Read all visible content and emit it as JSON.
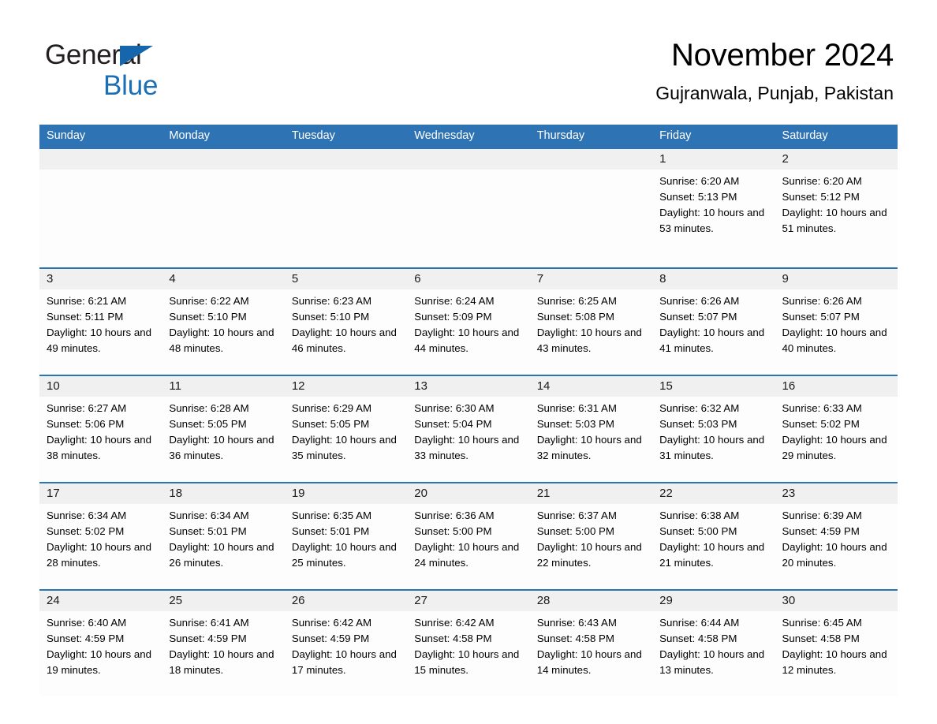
{
  "brand": {
    "name_part1": "General",
    "name_part2": "Blue",
    "triangle_color": "#1566ad",
    "blue_color": "#1b6fb5"
  },
  "header": {
    "title": "November 2024",
    "subtitle": "Gujranwala, Punjab, Pakistan"
  },
  "theme": {
    "header_blue": "#2e74b5",
    "date_strip_gray": "#f0f0f0",
    "cell_background": "#fdfdfd",
    "text_color": "#000000"
  },
  "weekdays": [
    "Sunday",
    "Monday",
    "Tuesday",
    "Wednesday",
    "Thursday",
    "Friday",
    "Saturday"
  ],
  "labels": {
    "sunrise_prefix": "Sunrise:",
    "sunset_prefix": "Sunset:",
    "daylight_prefix": "Daylight:"
  },
  "weeks": [
    {
      "days": [
        {
          "date": "",
          "empty": true
        },
        {
          "date": "",
          "empty": true
        },
        {
          "date": "",
          "empty": true
        },
        {
          "date": "",
          "empty": true
        },
        {
          "date": "",
          "empty": true
        },
        {
          "date": "1",
          "empty": false,
          "sunrise": "Sunrise: 6:20 AM",
          "sunset": "Sunset: 5:13 PM",
          "daylight": "Daylight: 10 hours and 53 minutes."
        },
        {
          "date": "2",
          "empty": false,
          "sunrise": "Sunrise: 6:20 AM",
          "sunset": "Sunset: 5:12 PM",
          "daylight": "Daylight: 10 hours and 51 minutes."
        }
      ]
    },
    {
      "days": [
        {
          "date": "3",
          "empty": false,
          "sunrise": "Sunrise: 6:21 AM",
          "sunset": "Sunset: 5:11 PM",
          "daylight": "Daylight: 10 hours and 49 minutes."
        },
        {
          "date": "4",
          "empty": false,
          "sunrise": "Sunrise: 6:22 AM",
          "sunset": "Sunset: 5:10 PM",
          "daylight": "Daylight: 10 hours and 48 minutes."
        },
        {
          "date": "5",
          "empty": false,
          "sunrise": "Sunrise: 6:23 AM",
          "sunset": "Sunset: 5:10 PM",
          "daylight": "Daylight: 10 hours and 46 minutes."
        },
        {
          "date": "6",
          "empty": false,
          "sunrise": "Sunrise: 6:24 AM",
          "sunset": "Sunset: 5:09 PM",
          "daylight": "Daylight: 10 hours and 44 minutes."
        },
        {
          "date": "7",
          "empty": false,
          "sunrise": "Sunrise: 6:25 AM",
          "sunset": "Sunset: 5:08 PM",
          "daylight": "Daylight: 10 hours and 43 minutes."
        },
        {
          "date": "8",
          "empty": false,
          "sunrise": "Sunrise: 6:26 AM",
          "sunset": "Sunset: 5:07 PM",
          "daylight": "Daylight: 10 hours and 41 minutes."
        },
        {
          "date": "9",
          "empty": false,
          "sunrise": "Sunrise: 6:26 AM",
          "sunset": "Sunset: 5:07 PM",
          "daylight": "Daylight: 10 hours and 40 minutes."
        }
      ]
    },
    {
      "days": [
        {
          "date": "10",
          "empty": false,
          "sunrise": "Sunrise: 6:27 AM",
          "sunset": "Sunset: 5:06 PM",
          "daylight": "Daylight: 10 hours and 38 minutes."
        },
        {
          "date": "11",
          "empty": false,
          "sunrise": "Sunrise: 6:28 AM",
          "sunset": "Sunset: 5:05 PM",
          "daylight": "Daylight: 10 hours and 36 minutes."
        },
        {
          "date": "12",
          "empty": false,
          "sunrise": "Sunrise: 6:29 AM",
          "sunset": "Sunset: 5:05 PM",
          "daylight": "Daylight: 10 hours and 35 minutes."
        },
        {
          "date": "13",
          "empty": false,
          "sunrise": "Sunrise: 6:30 AM",
          "sunset": "Sunset: 5:04 PM",
          "daylight": "Daylight: 10 hours and 33 minutes."
        },
        {
          "date": "14",
          "empty": false,
          "sunrise": "Sunrise: 6:31 AM",
          "sunset": "Sunset: 5:03 PM",
          "daylight": "Daylight: 10 hours and 32 minutes."
        },
        {
          "date": "15",
          "empty": false,
          "sunrise": "Sunrise: 6:32 AM",
          "sunset": "Sunset: 5:03 PM",
          "daylight": "Daylight: 10 hours and 31 minutes."
        },
        {
          "date": "16",
          "empty": false,
          "sunrise": "Sunrise: 6:33 AM",
          "sunset": "Sunset: 5:02 PM",
          "daylight": "Daylight: 10 hours and 29 minutes."
        }
      ]
    },
    {
      "days": [
        {
          "date": "17",
          "empty": false,
          "sunrise": "Sunrise: 6:34 AM",
          "sunset": "Sunset: 5:02 PM",
          "daylight": "Daylight: 10 hours and 28 minutes."
        },
        {
          "date": "18",
          "empty": false,
          "sunrise": "Sunrise: 6:34 AM",
          "sunset": "Sunset: 5:01 PM",
          "daylight": "Daylight: 10 hours and 26 minutes."
        },
        {
          "date": "19",
          "empty": false,
          "sunrise": "Sunrise: 6:35 AM",
          "sunset": "Sunset: 5:01 PM",
          "daylight": "Daylight: 10 hours and 25 minutes."
        },
        {
          "date": "20",
          "empty": false,
          "sunrise": "Sunrise: 6:36 AM",
          "sunset": "Sunset: 5:00 PM",
          "daylight": "Daylight: 10 hours and 24 minutes."
        },
        {
          "date": "21",
          "empty": false,
          "sunrise": "Sunrise: 6:37 AM",
          "sunset": "Sunset: 5:00 PM",
          "daylight": "Daylight: 10 hours and 22 minutes."
        },
        {
          "date": "22",
          "empty": false,
          "sunrise": "Sunrise: 6:38 AM",
          "sunset": "Sunset: 5:00 PM",
          "daylight": "Daylight: 10 hours and 21 minutes."
        },
        {
          "date": "23",
          "empty": false,
          "sunrise": "Sunrise: 6:39 AM",
          "sunset": "Sunset: 4:59 PM",
          "daylight": "Daylight: 10 hours and 20 minutes."
        }
      ]
    },
    {
      "days": [
        {
          "date": "24",
          "empty": false,
          "sunrise": "Sunrise: 6:40 AM",
          "sunset": "Sunset: 4:59 PM",
          "daylight": "Daylight: 10 hours and 19 minutes."
        },
        {
          "date": "25",
          "empty": false,
          "sunrise": "Sunrise: 6:41 AM",
          "sunset": "Sunset: 4:59 PM",
          "daylight": "Daylight: 10 hours and 18 minutes."
        },
        {
          "date": "26",
          "empty": false,
          "sunrise": "Sunrise: 6:42 AM",
          "sunset": "Sunset: 4:59 PM",
          "daylight": "Daylight: 10 hours and 17 minutes."
        },
        {
          "date": "27",
          "empty": false,
          "sunrise": "Sunrise: 6:42 AM",
          "sunset": "Sunset: 4:58 PM",
          "daylight": "Daylight: 10 hours and 15 minutes."
        },
        {
          "date": "28",
          "empty": false,
          "sunrise": "Sunrise: 6:43 AM",
          "sunset": "Sunset: 4:58 PM",
          "daylight": "Daylight: 10 hours and 14 minutes."
        },
        {
          "date": "29",
          "empty": false,
          "sunrise": "Sunrise: 6:44 AM",
          "sunset": "Sunset: 4:58 PM",
          "daylight": "Daylight: 10 hours and 13 minutes."
        },
        {
          "date": "30",
          "empty": false,
          "sunrise": "Sunrise: 6:45 AM",
          "sunset": "Sunset: 4:58 PM",
          "daylight": "Daylight: 10 hours and 12 minutes."
        }
      ]
    }
  ]
}
